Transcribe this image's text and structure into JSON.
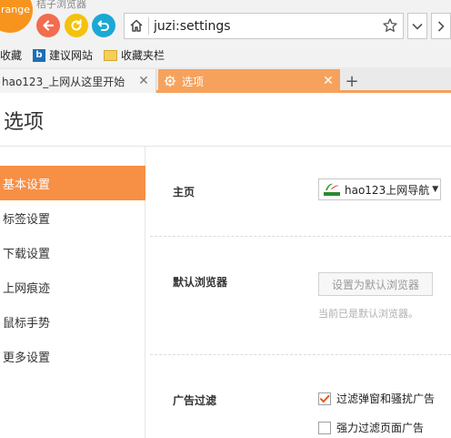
{
  "window": {
    "logo_text": "range",
    "title": "桔子浏览器"
  },
  "toolbar": {
    "address_value": "juzi:settings"
  },
  "bookmarks": {
    "items": [
      {
        "label": "收藏",
        "icon": "none"
      },
      {
        "label": "建议网站",
        "icon": "bing-icon"
      },
      {
        "label": "收藏夹栏",
        "icon": "folder-icon"
      }
    ]
  },
  "tabs": [
    {
      "label": "hao123_上网从这里开始",
      "active": false
    },
    {
      "label": "选项",
      "active": true
    }
  ],
  "page": {
    "title": "选项"
  },
  "sidebar": {
    "items": [
      {
        "label": "基本设置",
        "active": true
      },
      {
        "label": "标签设置",
        "active": false
      },
      {
        "label": "下载设置",
        "active": false
      },
      {
        "label": "上网痕迹",
        "active": false
      },
      {
        "label": "鼠标手势",
        "active": false
      },
      {
        "label": "更多设置",
        "active": false
      }
    ]
  },
  "settings": {
    "homepage": {
      "label": "主页",
      "selected": "hao123上网导航"
    },
    "default_browser": {
      "label": "默认浏览器",
      "button": "设置为默认浏览器",
      "note": "当前已是默认浏览器。"
    },
    "ad_filter": {
      "label": "广告过滤",
      "options": [
        {
          "label": "过滤弹窗和骚扰广告",
          "checked": true
        },
        {
          "label": "强力过滤页面广告",
          "checked": false
        }
      ]
    }
  },
  "colors": {
    "accent": "#f78f45",
    "tab_active": "#f7a25c",
    "back": "#f26c4f",
    "refresh": "#f4c20d",
    "undo": "#1aa9d4"
  }
}
